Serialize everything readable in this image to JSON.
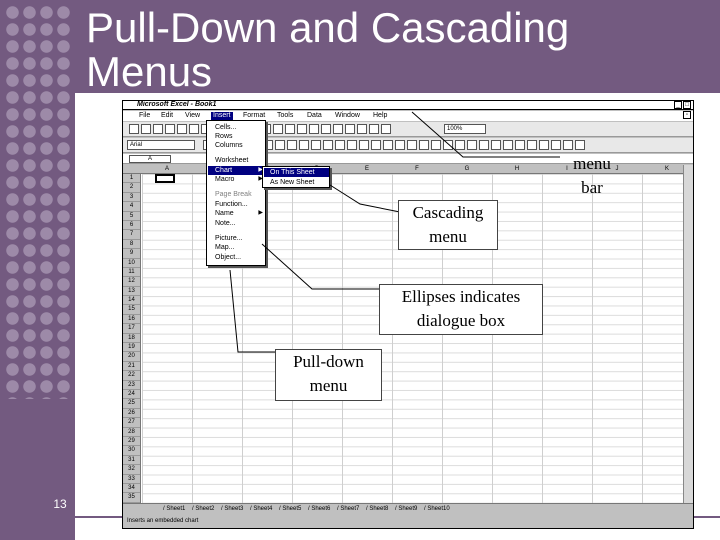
{
  "slide": {
    "title_line1": "Pull-Down and Cascading",
    "title_line2": "Menus",
    "number": "13"
  },
  "excel": {
    "title": "Microsoft Excel - Book1",
    "menus": [
      "File",
      "Edit",
      "View",
      "Insert",
      "Format",
      "Tools",
      "Data",
      "Window",
      "Help"
    ],
    "active_menu": "Insert",
    "zoom": "100%",
    "font": "Arial",
    "name_box": "A",
    "columns": [
      "A",
      "B",
      "C",
      "D",
      "E",
      "F",
      "G",
      "H",
      "I",
      "J",
      "K",
      "D"
    ],
    "rows": [
      "1",
      "2",
      "3",
      "4",
      "5",
      "6",
      "7",
      "8",
      "9",
      "10",
      "11",
      "12",
      "13",
      "14",
      "15",
      "16",
      "17",
      "18",
      "19",
      "20",
      "21",
      "22",
      "23",
      "24",
      "25",
      "26",
      "27",
      "28",
      "29",
      "30",
      "31",
      "32",
      "33",
      "34",
      "35"
    ],
    "sheet_tabs": [
      "Sheet1",
      "Sheet2",
      "Sheet3",
      "Sheet4",
      "Sheet5",
      "Sheet6",
      "Sheet7",
      "Sheet8",
      "Sheet9",
      "Sheet10"
    ],
    "status": "Inserts an embedded chart"
  },
  "insert_menu": {
    "items": [
      {
        "label": "Cells...",
        "dim": false
      },
      {
        "label": "Rows",
        "dim": false
      },
      {
        "label": "Columns",
        "dim": false
      },
      {
        "label": "Worksheet",
        "dim": false
      },
      {
        "label": "Chart",
        "dim": false,
        "highlight": true,
        "submenu": true
      },
      {
        "label": "Macro",
        "dim": false,
        "submenu": true
      },
      {
        "label": "Page Break",
        "dim": true
      },
      {
        "label": "Function...",
        "dim": false
      },
      {
        "label": "Name",
        "dim": false,
        "submenu": true
      },
      {
        "label": "Note...",
        "dim": false
      },
      {
        "label": "Picture...",
        "dim": false
      },
      {
        "label": "Map...",
        "dim": false
      },
      {
        "label": "Object...",
        "dim": false
      }
    ]
  },
  "chart_submenu": {
    "items": [
      {
        "label": "On This Sheet",
        "highlight": true
      },
      {
        "label": "As New Sheet",
        "highlight": false
      }
    ]
  },
  "callouts": {
    "menu_bar": {
      "line1": "menu",
      "line2": "bar"
    },
    "cascading": {
      "line1": "Cascading",
      "line2": "menu"
    },
    "ellipses": {
      "line1": "Ellipses indicates",
      "line2": "dialogue box"
    },
    "pulldown": {
      "line1": "Pull-down",
      "line2": "menu"
    }
  }
}
